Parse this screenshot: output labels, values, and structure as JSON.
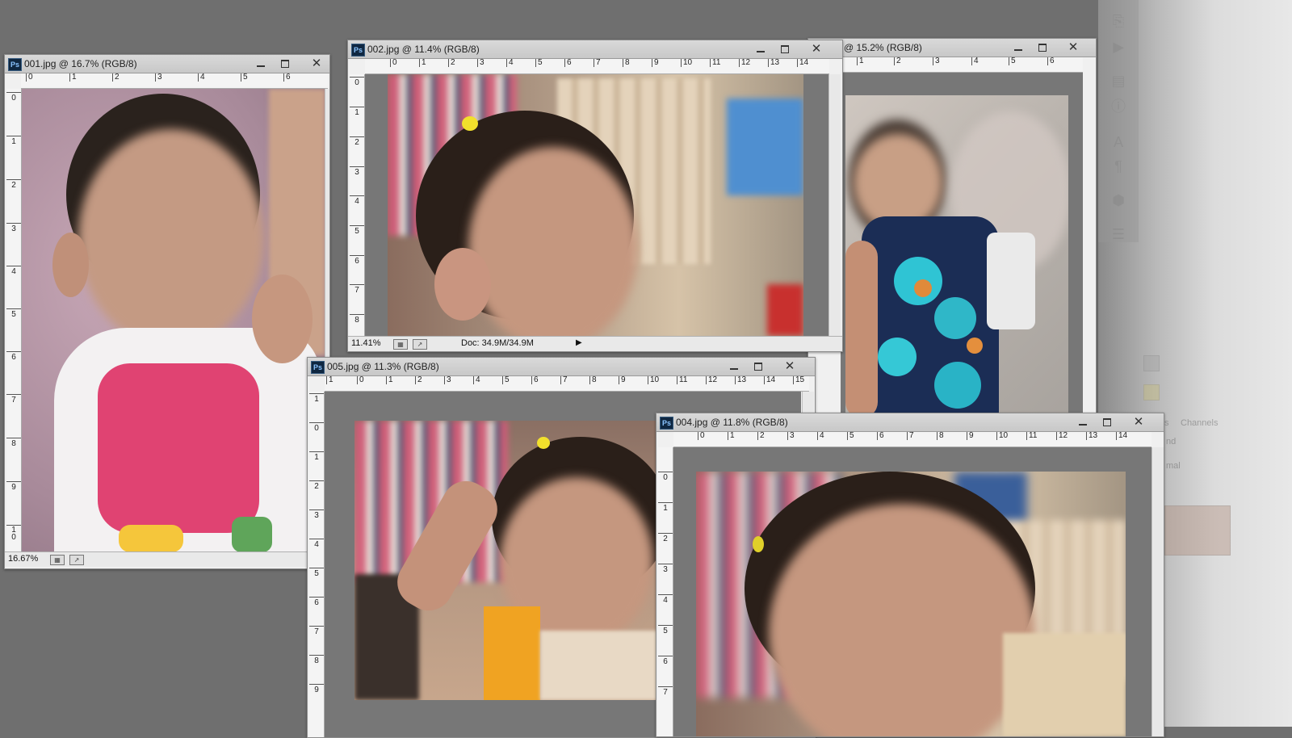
{
  "windows": {
    "w001": {
      "title": "001.jpg @ 16.7% (RGB/8)",
      "zoom": "16.67%",
      "ruler_h": [
        "0",
        "1",
        "2",
        "3",
        "4",
        "5",
        "6"
      ],
      "ruler_v": [
        "0",
        "1",
        "2",
        "3",
        "4",
        "5",
        "6",
        "7",
        "8",
        "9",
        "1\n0"
      ]
    },
    "w002": {
      "title": "002.jpg @ 11.4% (RGB/8)",
      "zoom": "11.41%",
      "doc": "Doc: 34.9M/34.9M",
      "ruler_h": [
        "0",
        "1",
        "2",
        "3",
        "4",
        "5",
        "6",
        "7",
        "8",
        "9",
        "10",
        "11",
        "12",
        "13",
        "14"
      ],
      "ruler_v": [
        "0",
        "1",
        "2",
        "3",
        "4",
        "5",
        "6",
        "7",
        "8"
      ]
    },
    "w003": {
      "title": "@ 15.2% (RGB/8)",
      "ruler_h": [
        "1",
        "2",
        "3",
        "4",
        "5",
        "6"
      ]
    },
    "w005": {
      "title": "005.jpg @ 11.3% (RGB/8)",
      "ruler_h": [
        "1",
        "0",
        "1",
        "2",
        "3",
        "4",
        "5",
        "6",
        "7",
        "8",
        "9",
        "10",
        "11",
        "12",
        "13",
        "14",
        "15"
      ],
      "ruler_v": [
        "1",
        "0",
        "1",
        "2",
        "3",
        "4",
        "5",
        "6",
        "7",
        "8",
        "9"
      ]
    },
    "w004": {
      "title": "004.jpg @ 11.8% (RGB/8)",
      "ruler_h": [
        "0",
        "1",
        "2",
        "3",
        "4",
        "5",
        "6",
        "7",
        "8",
        "9",
        "10",
        "11",
        "12",
        "13",
        "14"
      ],
      "ruler_v": [
        "0",
        "1",
        "2",
        "3",
        "4",
        "5",
        "6",
        "7"
      ]
    }
  },
  "window_buttons": {
    "minimize": "",
    "maximize": "",
    "close": "✕"
  },
  "icons": {
    "ps": "Ps"
  },
  "right_panel": {
    "tab_label": "Channels",
    "tab_prefix": "s",
    "blend_partial": "nd",
    "opacity_partial": "mal"
  }
}
